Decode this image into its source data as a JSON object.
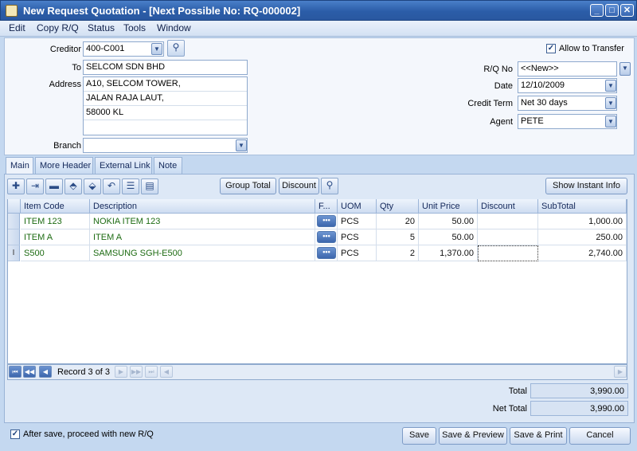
{
  "window": {
    "title": "New Request Quotation - [Next Possible No: RQ-000002]",
    "minimize": "_",
    "restore": "□",
    "close": "✕"
  },
  "menu": [
    "Edit",
    "Copy R/Q",
    "Status",
    "Tools",
    "Window"
  ],
  "header": {
    "creditor_label": "Creditor",
    "creditor_value": "400-C001",
    "to_label": "To",
    "to_value": "SELCOM SDN BHD",
    "address_label": "Address",
    "address_lines": [
      "A10, SELCOM TOWER,",
      "JALAN RAJA LAUT,",
      "58000 KL",
      ""
    ],
    "branch_label": "Branch",
    "branch_value": "",
    "allow_transfer_label": "Allow to Transfer",
    "allow_transfer_checked": true,
    "rq_no_label": "R/Q  No",
    "rq_no_value": "<<New>>",
    "date_label": "Date",
    "date_value": "12/10/2009",
    "credit_term_label": "Credit Term",
    "credit_term_value": "Net 30 days",
    "agent_label": "Agent",
    "agent_value": "PETE"
  },
  "tabs": [
    "Main",
    "More Header",
    "External Link",
    "Note"
  ],
  "toolbar": {
    "group_total": "Group Total",
    "discount": "Discount",
    "show_instant_info": "Show Instant Info"
  },
  "grid": {
    "columns": [
      "Item Code",
      "Description",
      "F...",
      "UOM",
      "Qty",
      "Unit Price",
      "Discount",
      "SubTotal"
    ],
    "rows": [
      {
        "item_code": "ITEM 123",
        "description": "NOKIA ITEM 123",
        "f": "•••",
        "uom": "PCS",
        "qty": "20",
        "unit_price": "50.00",
        "discount": "",
        "subtotal": "1,000.00"
      },
      {
        "item_code": "ITEM A",
        "description": "ITEM A",
        "f": "•••",
        "uom": "PCS",
        "qty": "5",
        "unit_price": "50.00",
        "discount": "",
        "subtotal": "250.00"
      },
      {
        "item_code": "S500",
        "description": "SAMSUNG SGH-E500",
        "f": "•••",
        "uom": "PCS",
        "qty": "2",
        "unit_price": "1,370.00",
        "discount": "",
        "subtotal": "2,740.00"
      }
    ],
    "current_row_marker": "I"
  },
  "navigator": {
    "record_text": "Record 3 of 3"
  },
  "totals": {
    "total_label": "Total",
    "total_value": "3,990.00",
    "net_total_label": "Net Total",
    "net_total_value": "3,990.00"
  },
  "footer": {
    "after_save_label": "After save, proceed with new R/Q",
    "after_save_checked": true,
    "save": "Save",
    "save_preview": "Save & Preview",
    "save_print": "Save & Print",
    "cancel": "Cancel"
  }
}
